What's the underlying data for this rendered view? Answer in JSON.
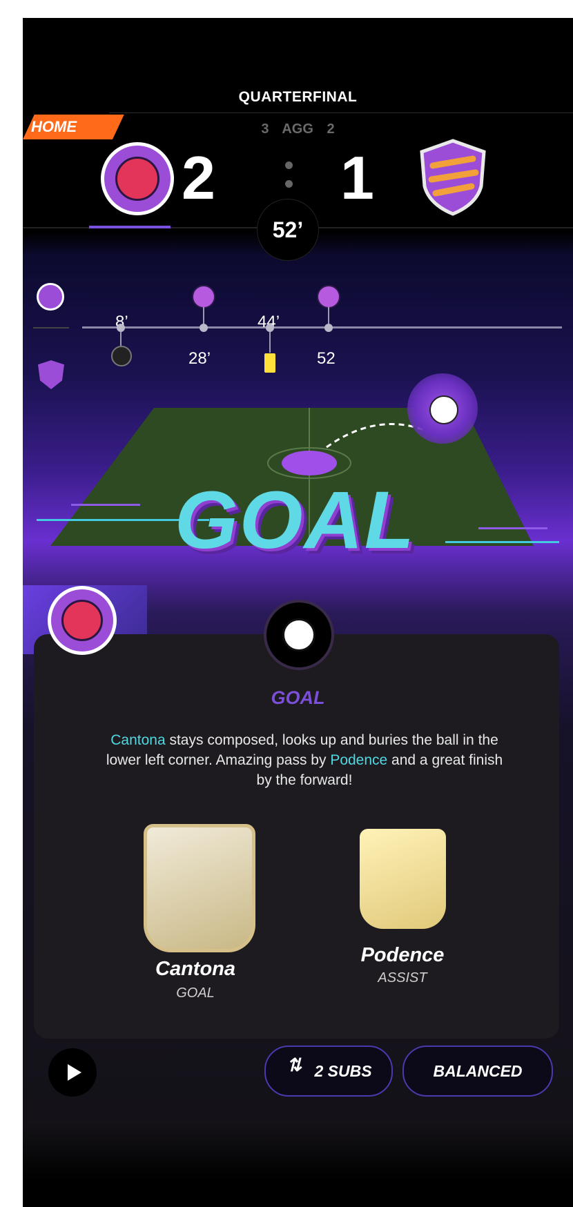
{
  "match": {
    "round": "QUARTERFINAL",
    "home_badge": "HOME",
    "aggregate": {
      "home": "3",
      "label": "AGG",
      "away": "2"
    },
    "score": {
      "home": "2",
      "away": "1"
    },
    "minute": "52’"
  },
  "timeline": {
    "home_events": [
      {
        "minute": "8’",
        "type": "goal"
      },
      {
        "minute": "44’",
        "type": "yellow-card"
      }
    ],
    "away_events": [
      {
        "minute": "28’",
        "type": "goal"
      },
      {
        "minute": "52",
        "type": "goal"
      }
    ],
    "colors": {
      "accent_purple": "#b65adf",
      "yellow_card": "#ffe03a"
    }
  },
  "highlight": {
    "banner": "GOAL",
    "event_title": "GOAL",
    "description": {
      "player1": "Cantona",
      "part1": " stays composed, looks up and buries the ball in the lower left corner. Amazing pass by ",
      "player2": "Podence",
      "part2": " and a great finish by the forward!"
    },
    "players": [
      {
        "name": "Cantona",
        "role": "GOAL"
      },
      {
        "name": "Podence",
        "role": "ASSIST"
      }
    ]
  },
  "controls": {
    "play_icon": "play-icon",
    "subs_label": "2 SUBS",
    "tactic_label": "BALANCED"
  },
  "colors": {
    "home_orange": "#ff6a1a",
    "highlight_cyan": "#4fd8e2",
    "purple": "#7b4fd8"
  }
}
